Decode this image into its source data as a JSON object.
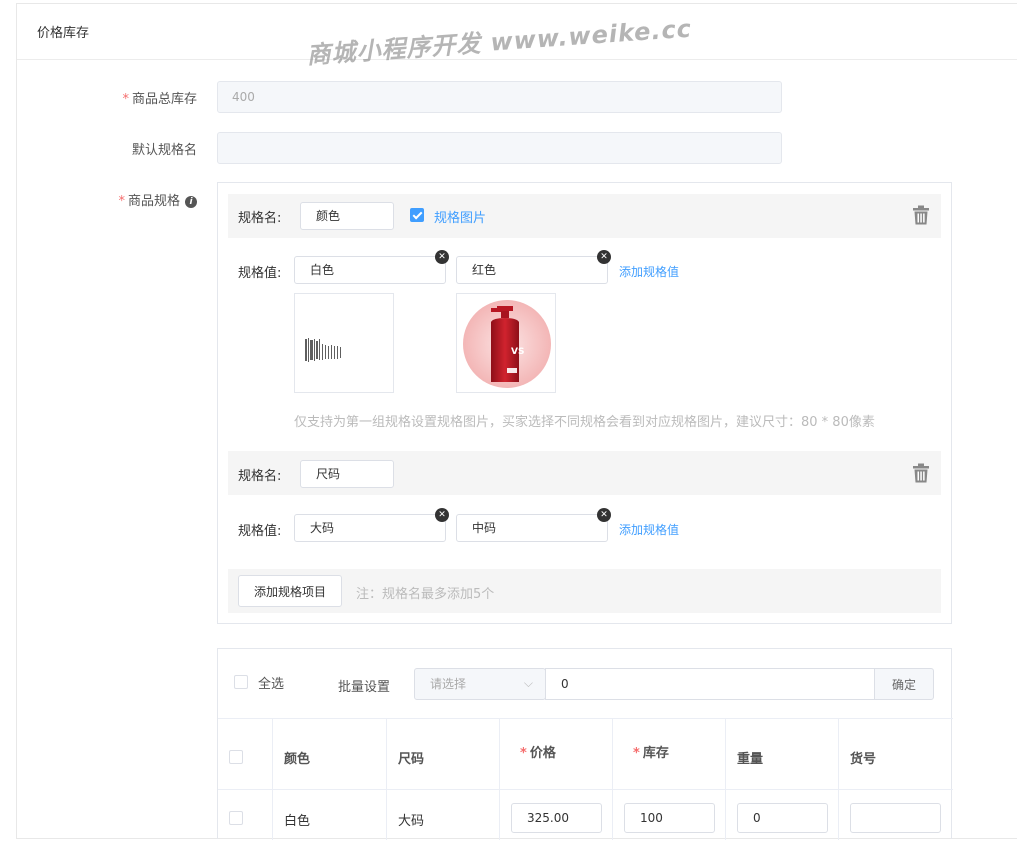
{
  "panel": {
    "title": "价格库存"
  },
  "watermark": "商城小程序开发 www.weike.cc",
  "form": {
    "total_stock": {
      "label": "商品总库存",
      "value": "400"
    },
    "default_spec": {
      "label": "默认规格名",
      "value": ""
    },
    "specs_label": "商品规格"
  },
  "specs": {
    "name_label": "规格名:",
    "value_label": "规格值:",
    "add_value": "添加规格值",
    "spec_image_label": "规格图片",
    "groups": [
      {
        "name": "颜色",
        "values": [
          "白色",
          "红色"
        ],
        "spec_image": true
      },
      {
        "name": "尺码",
        "values": [
          "大码",
          "中码"
        ],
        "spec_image": false
      }
    ],
    "image_hint": "仅支持为第一组规格设置规格图片，买家选择不同规格会看到对应规格图片，建议尺寸：80 * 80像素",
    "add_item_button": "添加规格项目",
    "add_item_note": "注：规格名最多添加5个",
    "trash_icon": "trash-icon",
    "info_icon": "info-icon",
    "close_icon": "close-icon"
  },
  "batch": {
    "select_all": "全选",
    "label": "批量设置",
    "select_placeholder": "请选择",
    "value": "0",
    "confirm": "确定"
  },
  "table": {
    "headers": [
      "颜色",
      "尺码",
      "价格",
      "库存",
      "重量",
      "货号"
    ],
    "rows": [
      {
        "color": "白色",
        "size": "大码",
        "price": "325.00",
        "stock": "100",
        "weight": "0",
        "sku": ""
      }
    ]
  },
  "colors": {
    "accent": "#409eff",
    "required": "#f56c6c"
  }
}
